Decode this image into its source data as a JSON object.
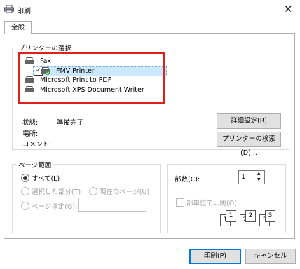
{
  "window": {
    "title": "印刷"
  },
  "tabs": [
    {
      "label": "全般"
    }
  ],
  "printer_select": {
    "group_label": "プリンターの選択",
    "printers": [
      {
        "name": "Fax"
      },
      {
        "name": "FMV Printer"
      },
      {
        "name": "Microsoft Print to PDF"
      },
      {
        "name": "Microsoft XPS Document Writer"
      }
    ],
    "selected": "FMV Printer",
    "status_label": "状態:",
    "status_value": "準備完了",
    "location_label": "場所:",
    "comment_label": "コメント:",
    "advanced_button": "詳細設定(R)",
    "find_printer_button": "プリンターの検索(D)..."
  },
  "page_range": {
    "group_label": "ページ範囲",
    "all": "すべて(L)",
    "selection": "選択した部分(T)",
    "current_page": "現在のページ(U)",
    "pages": "ページ指定(G):",
    "pages_value": ""
  },
  "copies": {
    "label": "部数(C):",
    "value": "1",
    "collate": "部単位で印刷(O)",
    "collate_pages": [
      "1",
      "1",
      "2",
      "2",
      "3",
      "3"
    ]
  },
  "footer": {
    "print_button": "印刷(P)",
    "cancel_button": "キャンセル"
  },
  "colors": {
    "accent": "#0078d7",
    "highlight": "#e0201a",
    "selection": "#cce8ff"
  }
}
